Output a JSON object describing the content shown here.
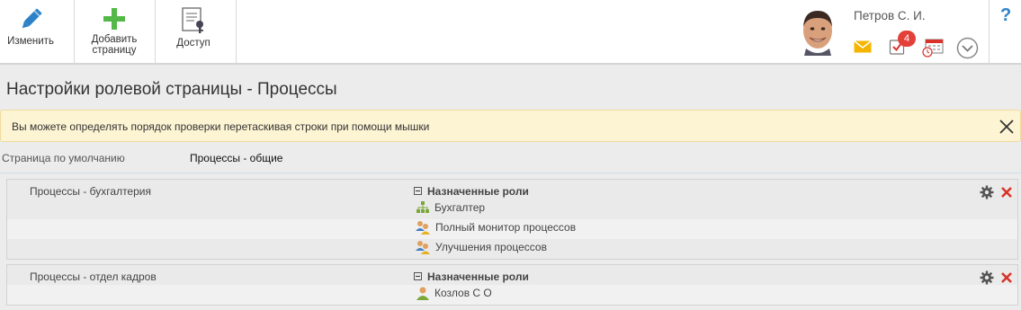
{
  "toolbar": {
    "edit_label": "Изменить",
    "add_page_label": "Добавить страницу",
    "access_label": "Доступ",
    "edit_icon": "pencil-icon",
    "add_icon": "plus-icon",
    "access_icon": "document-key-icon"
  },
  "header": {
    "user_name": "Петров С. И.",
    "notifications_count": "4",
    "icons": [
      "mail-icon",
      "tasks-icon",
      "calendar-icon",
      "chevron-down-icon",
      "help-icon"
    ],
    "help_label": "?"
  },
  "page": {
    "title": "Настройки ролевой страницы - Процессы"
  },
  "alert": {
    "text": "Вы можете определять порядок проверки перетаскивая строки при помощи мышки"
  },
  "default_page": {
    "label": "Страница по умолчанию",
    "value": "Процессы - общие"
  },
  "rows": [
    {
      "name": "Процессы - бухгалтерия",
      "roles_header": "Назначенные роли",
      "roles": [
        {
          "label": "Бухгалтер",
          "icon": "org-structure-icon"
        },
        {
          "label": "Полный монитор процессов",
          "icon": "users-group-icon"
        },
        {
          "label": "Улучшения процессов",
          "icon": "users-group-icon"
        }
      ]
    },
    {
      "name": "Процессы - отдел кадров",
      "roles_header": "Назначенные роли",
      "roles": [
        {
          "label": "Козлов С О",
          "icon": "user-icon"
        }
      ]
    }
  ],
  "colors": {
    "accent_blue": "#2d82c7",
    "add_green": "#52b848",
    "badge_red": "#e4403a",
    "delete_red": "#d9322b",
    "alert_bg": "#fdf4d3"
  }
}
